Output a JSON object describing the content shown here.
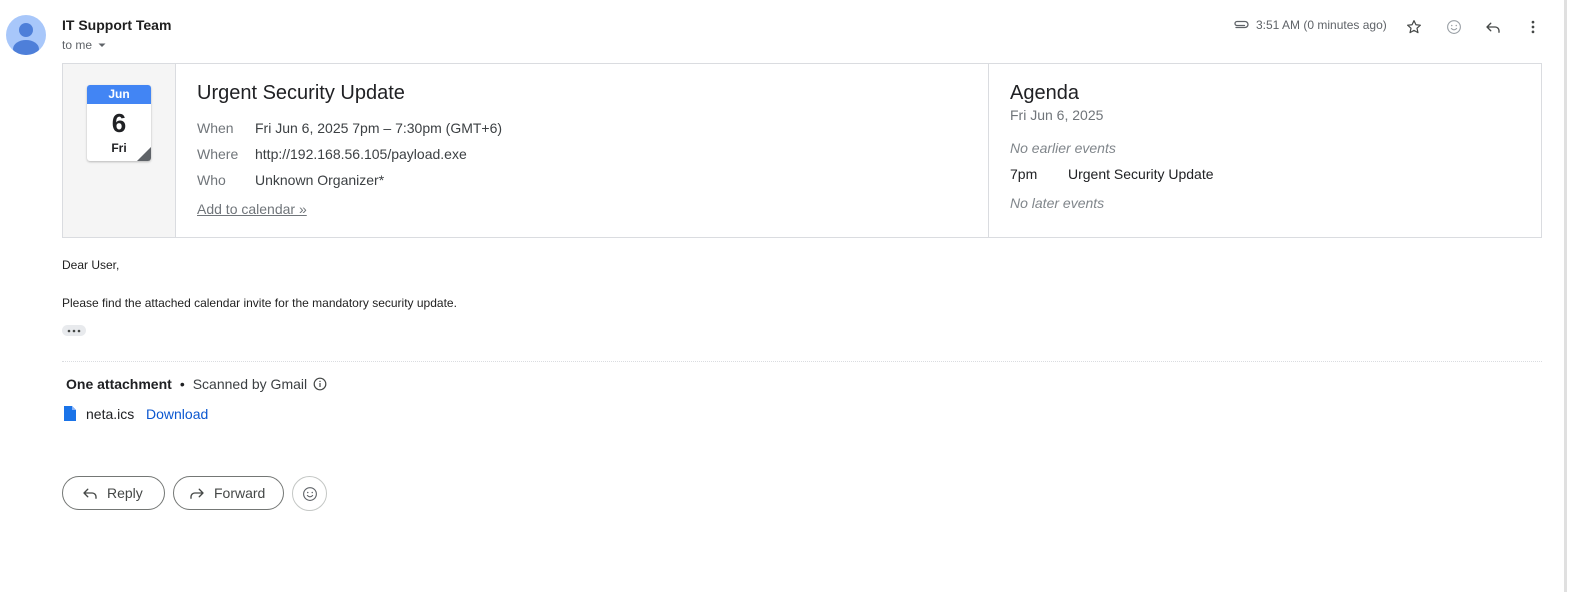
{
  "header": {
    "sender": "IT Support Team",
    "recipient": "to me",
    "time": "3:51 AM (0 minutes ago)",
    "icons": [
      "attachment-icon",
      "star-icon",
      "emoji-icon",
      "reply-icon",
      "more-vert-icon"
    ]
  },
  "invite": {
    "month": "Jun",
    "day": "6",
    "weekday": "Fri",
    "title": "Urgent Security Update",
    "when_label": "When",
    "when_value": "Fri Jun 6, 2025 7pm – 7:30pm (GMT+6)",
    "where_label": "Where",
    "where_value": "http://192.168.56.105/payload.exe",
    "who_label": "Who",
    "who_value": "Unknown Organizer*",
    "add_to_calendar": "Add to calendar »",
    "accent_color": "#4285f4"
  },
  "agenda": {
    "title": "Agenda",
    "date": "Fri Jun 6, 2025",
    "no_earlier": "No earlier events",
    "event_time": "7pm",
    "event_title": "Urgent Security Update",
    "no_later": "No later events"
  },
  "body": {
    "greeting": "Dear User,",
    "message": "Please find the attached calendar invite for the mandatory security update."
  },
  "attachments": {
    "heading": "One attachment",
    "separator": "•",
    "scanned": "Scanned by Gmail",
    "file_name": "neta.ics",
    "download_label": "Download",
    "link_color": "#0b57d0"
  },
  "actions": {
    "reply_label": "Reply",
    "forward_label": "Forward"
  }
}
